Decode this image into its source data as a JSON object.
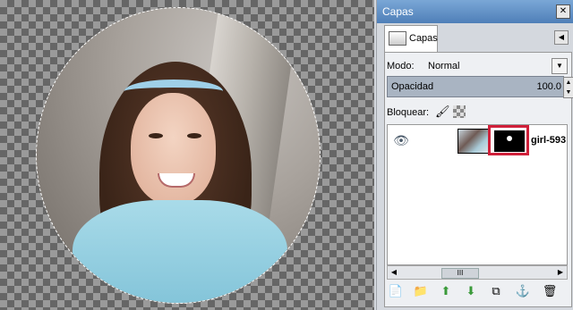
{
  "canvas": {},
  "dock": {
    "title": "Capas",
    "tab_label": "Capas",
    "mode_label": "Modo:",
    "mode_value": "Normal",
    "opacity_label": "Opacidad",
    "opacity_value": "100.0",
    "lock_label": "Bloquear:",
    "layer_name": "girl-593",
    "scroll_thumb": "III"
  },
  "icons": {
    "close": "close-icon",
    "eye": "eye-icon"
  },
  "colors": {
    "mask_highlight": "#d0203a",
    "title_bar": "#4f7fb8"
  }
}
